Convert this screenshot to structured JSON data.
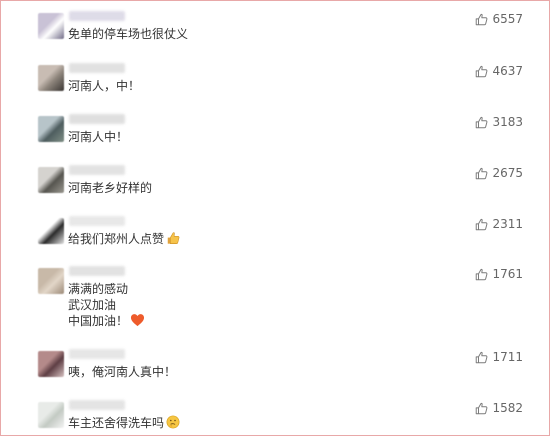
{
  "comments": [
    {
      "text_lines": [
        "免单的停车场也很仗义"
      ],
      "likes": "6557",
      "avatar_colors": [
        "#c9c2d6",
        "#ffffff",
        "#6f6a86"
      ],
      "name_color": "#d9d6e4"
    },
    {
      "text_lines": [
        "河南人，中！"
      ],
      "likes": "4637",
      "avatar_colors": [
        "#c8bcb3",
        "#8e857c",
        "#3a3633"
      ],
      "name_color": "#dcdcdc"
    },
    {
      "text_lines": [
        "河南人中！"
      ],
      "likes": "3183",
      "avatar_colors": [
        "#b7c4c9",
        "#4e5d5f",
        "#7f8f86"
      ],
      "name_color": "#dadada"
    },
    {
      "text_lines": [
        "河南老乡好样的"
      ],
      "likes": "2675",
      "avatar_colors": [
        "#d5d3cf",
        "#56554f",
        "#9a9890"
      ],
      "name_color": "#dedede"
    },
    {
      "text_lines": [
        "给我们郑州人点赞"
      ],
      "likes": "2311",
      "emoji": "thumbs-up",
      "avatar_colors": [
        "#ffffff",
        "#2b2b2b",
        "#e4e4e4"
      ],
      "name_color": "#e4e4e4"
    },
    {
      "text_lines": [
        "满满的感动",
        "武汉加油",
        "中国加油！"
      ],
      "likes": "1761",
      "emoji": "heart",
      "avatar_colors": [
        "#c8b9a8",
        "#e2d6c8",
        "#9c8a78"
      ],
      "name_color": "#dddddd"
    },
    {
      "text_lines": [
        "咦，俺河南人真中！"
      ],
      "likes": "1711",
      "avatar_colors": [
        "#b48a8a",
        "#5e3e44",
        "#d7c2c2"
      ],
      "name_color": "#e2e2e2"
    },
    {
      "text_lines": [
        "车主还舍得洗车吗"
      ],
      "likes": "1582",
      "emoji": "thinking",
      "avatar_colors": [
        "#e8ebe8",
        "#c3cac3",
        "#f4f4f4"
      ],
      "name_color": "#e0e0e0"
    }
  ],
  "colors": {
    "border": "#e8a8a8",
    "text": "#333333",
    "like": "#666666"
  }
}
